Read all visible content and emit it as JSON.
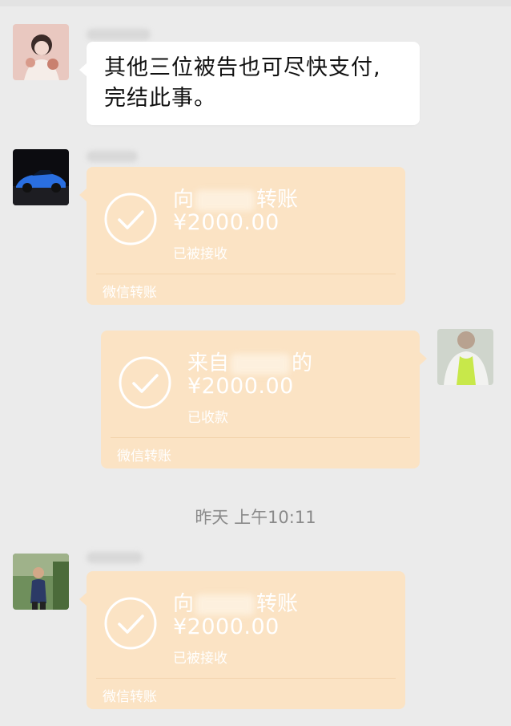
{
  "chat": {
    "messages": [
      {
        "type": "text",
        "side": "left",
        "text_line1": "其他三位被告也可尽快支付,",
        "text_line2": "完结此事。"
      },
      {
        "type": "transfer",
        "side": "left",
        "title_prefix": "向",
        "title_suffix": "转账",
        "amount": "¥2000.00",
        "status": "已被接收",
        "footer": "微信转账"
      },
      {
        "type": "transfer",
        "side": "right",
        "title_prefix": "来自",
        "title_suffix": "的",
        "amount": "¥2000.00",
        "status": "已收款",
        "footer": "微信转账"
      },
      {
        "type": "transfer",
        "side": "left",
        "title_prefix": "向",
        "title_suffix": "转账",
        "amount": "¥2000.00",
        "status": "已被接收",
        "footer": "微信转账"
      }
    ],
    "timestamp": "昨天 上午10:11"
  },
  "avatars": {
    "sender1": "woman-portrait-avatar",
    "sender2": "blue-sportscar-avatar",
    "me": "person-avatar",
    "sender3": "man-outdoor-avatar"
  },
  "colors": {
    "background": "#ebebeb",
    "text_bubble": "#ffffff",
    "transfer_bubble": "#fbe3c4"
  }
}
